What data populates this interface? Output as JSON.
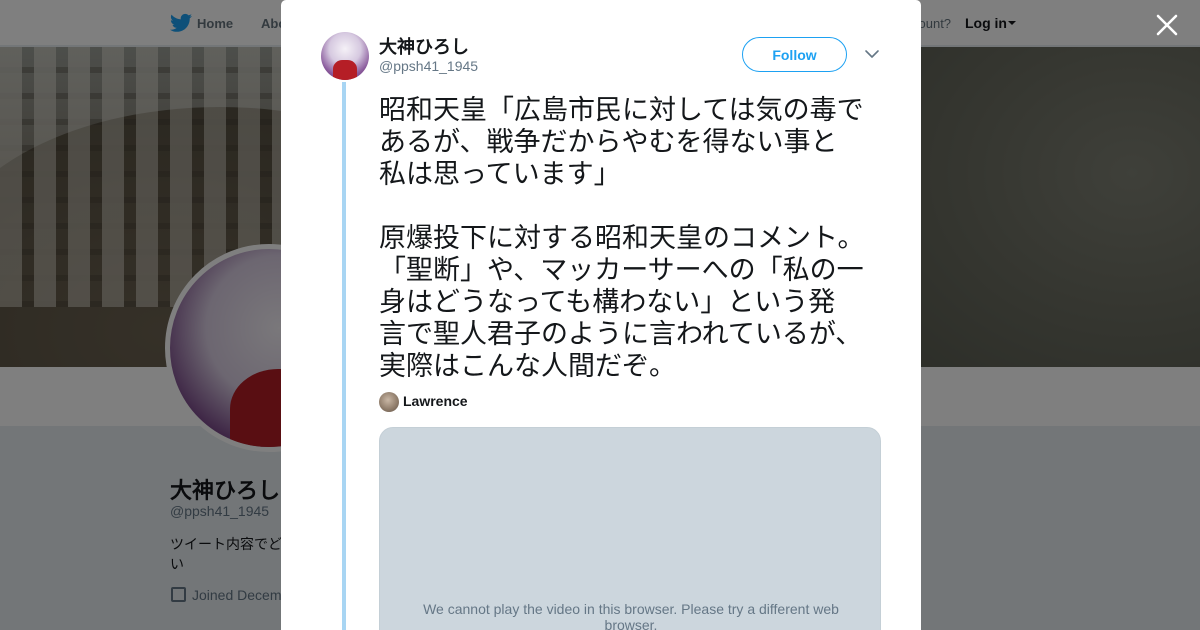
{
  "nav": {
    "home_label": "Home",
    "about_label": "Abo",
    "account_prompt": "count?",
    "login_label": "Log in"
  },
  "profile": {
    "name": "大神ひろし",
    "handle": "@ppsh41_1945",
    "bio": "ツイート内容でど い",
    "joined": "Joined Decem"
  },
  "tweet": {
    "author_name": "大神ひろし",
    "author_handle": "@ppsh41_1945",
    "follow_label": "Follow",
    "text": "昭和天皇「広島市民に対しては気の毒で\nあるが、戦争だからやむを得ない事と\n私は思っています」\n\n原爆投下に対する昭和天皇のコメント。\n「聖断」や、マッカーサーへの「私の一\n身はどうなっても構わない」という発\n言で聖人君子のように言われているが、\n実際はこんな人間だぞ。",
    "quoted_user": "Lawrence",
    "video_message": "We cannot play the video in this browser. Please try a different web browser."
  },
  "icons": {
    "nav_logo": "twitter-bird-icon",
    "close": "close-icon",
    "more": "chevron-down-icon",
    "calendar": "calendar-icon"
  },
  "colors": {
    "brand_blue": "#1da1f2",
    "thread_line": "#a8d5f3",
    "video_bg": "#ccd6dd",
    "text_primary": "#14171a",
    "text_secondary": "#657786"
  }
}
